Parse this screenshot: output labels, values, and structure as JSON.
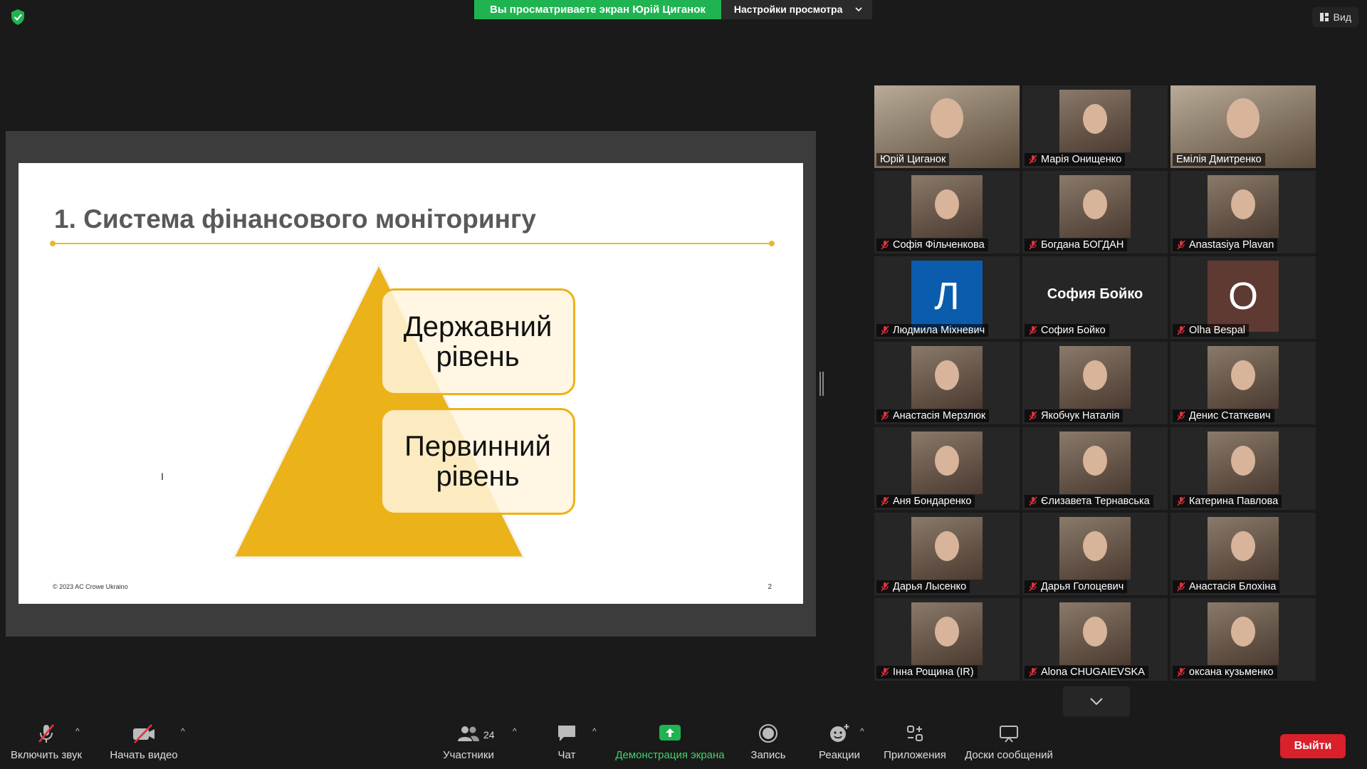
{
  "top": {
    "viewing_banner": "Вы просматриваете экран Юрій Циганок",
    "view_settings": "Настройки просмотра",
    "view_button": "Вид"
  },
  "slide": {
    "title": "1. Система фінансового моніторингу",
    "level_state": "Державний рівень",
    "level_primary": "Первинний рівень",
    "copyright": "© 2023 AC Crowe Ukraino",
    "page_number": "2"
  },
  "participants": [
    {
      "name": "Юрій Циганок",
      "muted": false,
      "type": "video",
      "active": true
    },
    {
      "name": "Марія Онищенко",
      "muted": true,
      "type": "photo"
    },
    {
      "name": "Емілія Дмитренко",
      "muted": false,
      "type": "wide"
    },
    {
      "name": "Софія Фільченкова",
      "muted": true,
      "type": "photo"
    },
    {
      "name": "Богдана БОГДАН",
      "muted": true,
      "type": "photo"
    },
    {
      "name": "Anastasiya Plavan",
      "muted": true,
      "type": "photo"
    },
    {
      "name": "Людмила Міхневич",
      "muted": true,
      "type": "letter",
      "letter": "Л",
      "color": "#0b5cad"
    },
    {
      "name": "София Бойко",
      "muted": true,
      "type": "text",
      "display": "София Бойко"
    },
    {
      "name": "Olha Bespal",
      "muted": true,
      "type": "letter",
      "letter": "O",
      "color": "#5e3a32"
    },
    {
      "name": "Анастасія Мерзлюк",
      "muted": true,
      "type": "photo"
    },
    {
      "name": "Якобчук Наталія",
      "muted": true,
      "type": "photo"
    },
    {
      "name": "Денис Статкевич",
      "muted": true,
      "type": "photo"
    },
    {
      "name": "Аня Бондаренко",
      "muted": true,
      "type": "photo"
    },
    {
      "name": "Єлизавета Тернавська",
      "muted": true,
      "type": "photo"
    },
    {
      "name": "Катерина Павлова",
      "muted": true,
      "type": "photo"
    },
    {
      "name": "Дарья Лысенко",
      "muted": true,
      "type": "photo"
    },
    {
      "name": "Дарья Голоцевич",
      "muted": true,
      "type": "photo"
    },
    {
      "name": "Анастасія Блохіна",
      "muted": true,
      "type": "photo"
    },
    {
      "name": "Інна Рощина (IR)",
      "muted": true,
      "type": "photo"
    },
    {
      "name": "Alona CHUGAIEVSKA",
      "muted": true,
      "type": "photo"
    },
    {
      "name": "оксана кузьменко",
      "muted": true,
      "type": "photo"
    }
  ],
  "toolbar": {
    "unmute": "Включить звук",
    "start_video": "Начать видео",
    "participants": "Участники",
    "participants_count": "24",
    "chat": "Чат",
    "share_screen": "Демонстрация экрана",
    "record": "Запись",
    "reactions": "Реакции",
    "apps": "Приложения",
    "whiteboards": "Доски сообщений",
    "leave": "Выйти"
  },
  "colors": {
    "share_green": "#1fb451",
    "pyramid_yellow": "#ecb21a",
    "leave_red": "#d9202b",
    "active_speaker": "#f4e04d"
  }
}
